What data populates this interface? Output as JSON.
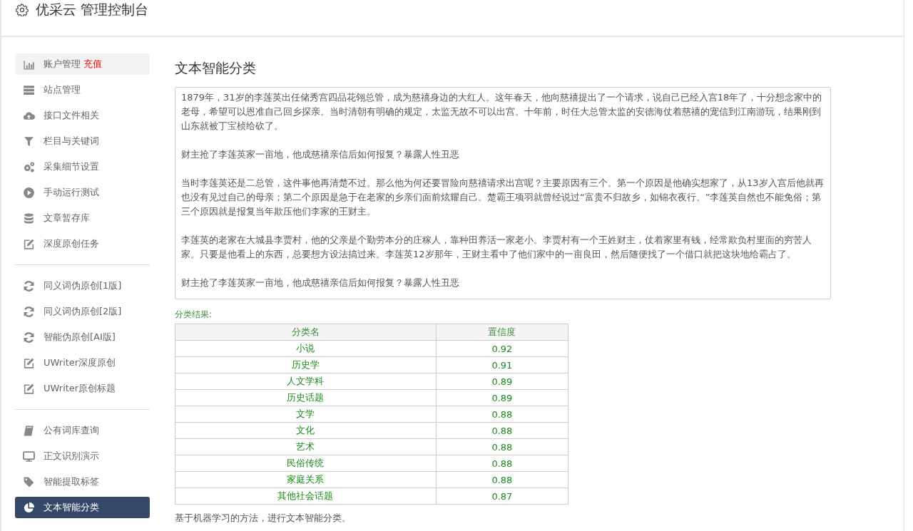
{
  "header": {
    "title": "优采云 管理控制台"
  },
  "sidebar": {
    "groups": [
      {
        "items": [
          {
            "kind": "chart",
            "label": "账户管理",
            "badge": "充值",
            "selected": false,
            "hover": true
          },
          {
            "kind": "server",
            "label": "站点管理",
            "selected": false
          },
          {
            "kind": "cloud",
            "label": "接口文件相关",
            "selected": false
          },
          {
            "kind": "filter",
            "label": "栏目与关键词",
            "selected": false
          },
          {
            "kind": "gears",
            "label": "采集细节设置",
            "selected": false
          },
          {
            "kind": "play",
            "label": "手动运行测试",
            "selected": false
          },
          {
            "kind": "database",
            "label": "文章暂存库",
            "selected": false
          },
          {
            "kind": "edit",
            "label": "深度原创任务",
            "selected": false
          }
        ]
      },
      {
        "items": [
          {
            "kind": "refresh",
            "label": "同义词伪原创[1版]",
            "selected": false
          },
          {
            "kind": "refresh",
            "label": "同义词伪原创[2版]",
            "selected": false
          },
          {
            "kind": "refresh",
            "label": "智能伪原创[AI版]",
            "selected": false
          },
          {
            "kind": "edit",
            "label": "UWriter深度原创",
            "selected": false
          },
          {
            "kind": "edit",
            "label": "UWriter原创标题",
            "selected": false
          }
        ]
      },
      {
        "items": [
          {
            "kind": "book",
            "label": "公有词库查询",
            "selected": false
          },
          {
            "kind": "monitor",
            "label": "正文识别演示",
            "selected": false
          },
          {
            "kind": "tag",
            "label": "智能提取标签",
            "selected": false
          },
          {
            "kind": "pie",
            "label": "文本智能分类",
            "selected": true
          }
        ]
      }
    ]
  },
  "main": {
    "title": "文本智能分类",
    "paragraphs": [
      "1879年，31岁的李莲英出任储秀宫四品花翎总管，成为慈禧身边的大红人。这年春天，他向慈禧提出了一个请求，说自己已经入宫18年了，十分想念家中的老母，希望可以恩准自己回乡探亲。当时清朝有明确的规定，太监无故不可以出宫。十年前，时任大总管太监的安德海仗着慈禧的宠信到江南游玩，结果刚到山东就被丁宝桢给砍了。",
      "财主抢了李莲英家一亩地，他成慈禧亲信后如何报复？暴露人性丑恶",
      "当时李莲英还是二总管，这件事他再清楚不过。那么他为何还要冒险向慈禧请求出宫呢？主要原因有三个。第一个原因是他确实想家了，从13岁入宫后他就再也没有见过自己的母亲；第二个原因是急于在老家的乡亲们面前炫耀自己。楚霸王项羽就曾经说过“富贵不归故乡，如锦衣夜行。”李莲英自然也不能免俗；第三个原因就是报复当年欺压他们李家的王财主。",
      "李莲英的老家在大城县李贾村，他的父亲是个勤劳本分的庄稼人，靠种田养活一家老小。李贾村有一个王姓财主，仗着家里有钱，经常欺负村里面的穷苦人家。只要是他看上的东西，总要想方设法搞过来。李莲英12岁那年，王财主看中了他们家中的一亩良田，然后随便找了一个借口就把这块地给霸占了。",
      "财主抢了李莲英家一亩地，他成慈禧亲信后如何报复？暴露人性丑恶"
    ],
    "result_label": "分类结果:",
    "table": {
      "columns": [
        "分类名",
        "置信度"
      ],
      "rows": [
        [
          "小说",
          "0.92"
        ],
        [
          "历史学",
          "0.91"
        ],
        [
          "人文学科",
          "0.89"
        ],
        [
          "历史话题",
          "0.89"
        ],
        [
          "文学",
          "0.88"
        ],
        [
          "文化",
          "0.88"
        ],
        [
          "艺术",
          "0.88"
        ],
        [
          "民俗传统",
          "0.88"
        ],
        [
          "家庭关系",
          "0.88"
        ],
        [
          "其他社会话题",
          "0.87"
        ]
      ]
    },
    "note": "基于机器学习的方法，进行文本智能分类。"
  }
}
